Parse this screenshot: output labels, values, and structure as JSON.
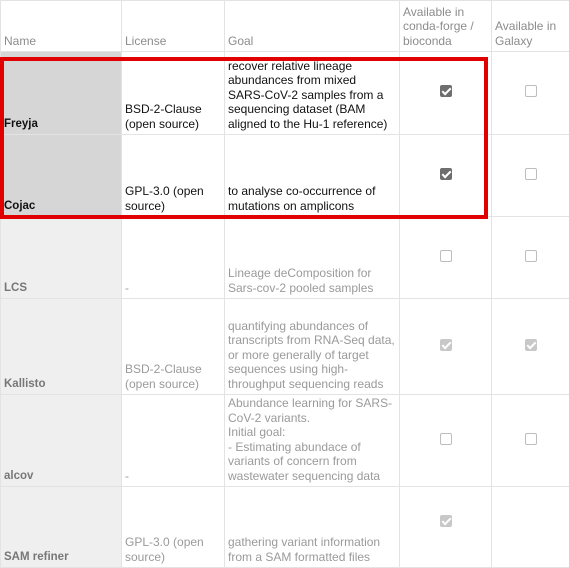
{
  "columns": [
    "Name",
    "License",
    "Goal",
    "Available in conda-forge / bioconda",
    "Available in Galaxy"
  ],
  "rows": [
    {
      "name": "Freyja",
      "license": "BSD-2-Clause (open source)",
      "goal": "recover relative lineage abundances from mixed SARS-CoV-2 samples from a sequencing dataset (BAM aligned to the Hu-1 reference)",
      "conda": true,
      "galaxy": false
    },
    {
      "name": "Cojac",
      "license": "GPL-3.0 (open source)",
      "goal": "to analyse co-occurrence of mutations on amplicons",
      "conda": true,
      "galaxy": false
    },
    {
      "name": "LCS",
      "license": "-",
      "goal": "Lineage deComposition for Sars-cov-2 pooled samples",
      "conda": false,
      "galaxy": false
    },
    {
      "name": "Kallisto",
      "license": "BSD-2-Clause (open source)",
      "goal": "quantifying abundances of transcripts from RNA-Seq data, or more generally of target sequences using high-throughput sequencing reads",
      "conda": true,
      "galaxy": true
    },
    {
      "name": "alcov",
      "license": "-",
      "goal": "Abundance learning for SARS-CoV-2 variants.\nInitial goal:\n- Estimating abundace of variants of concern from wastewater sequencing data",
      "conda": false,
      "galaxy": false
    },
    {
      "name": "SAM refiner",
      "license": "GPL-3.0 (open source)",
      "goal": "gathering variant information from a SAM formatted files",
      "conda": true,
      "galaxy": null
    }
  ],
  "highlight": {
    "color": "#e00000"
  }
}
